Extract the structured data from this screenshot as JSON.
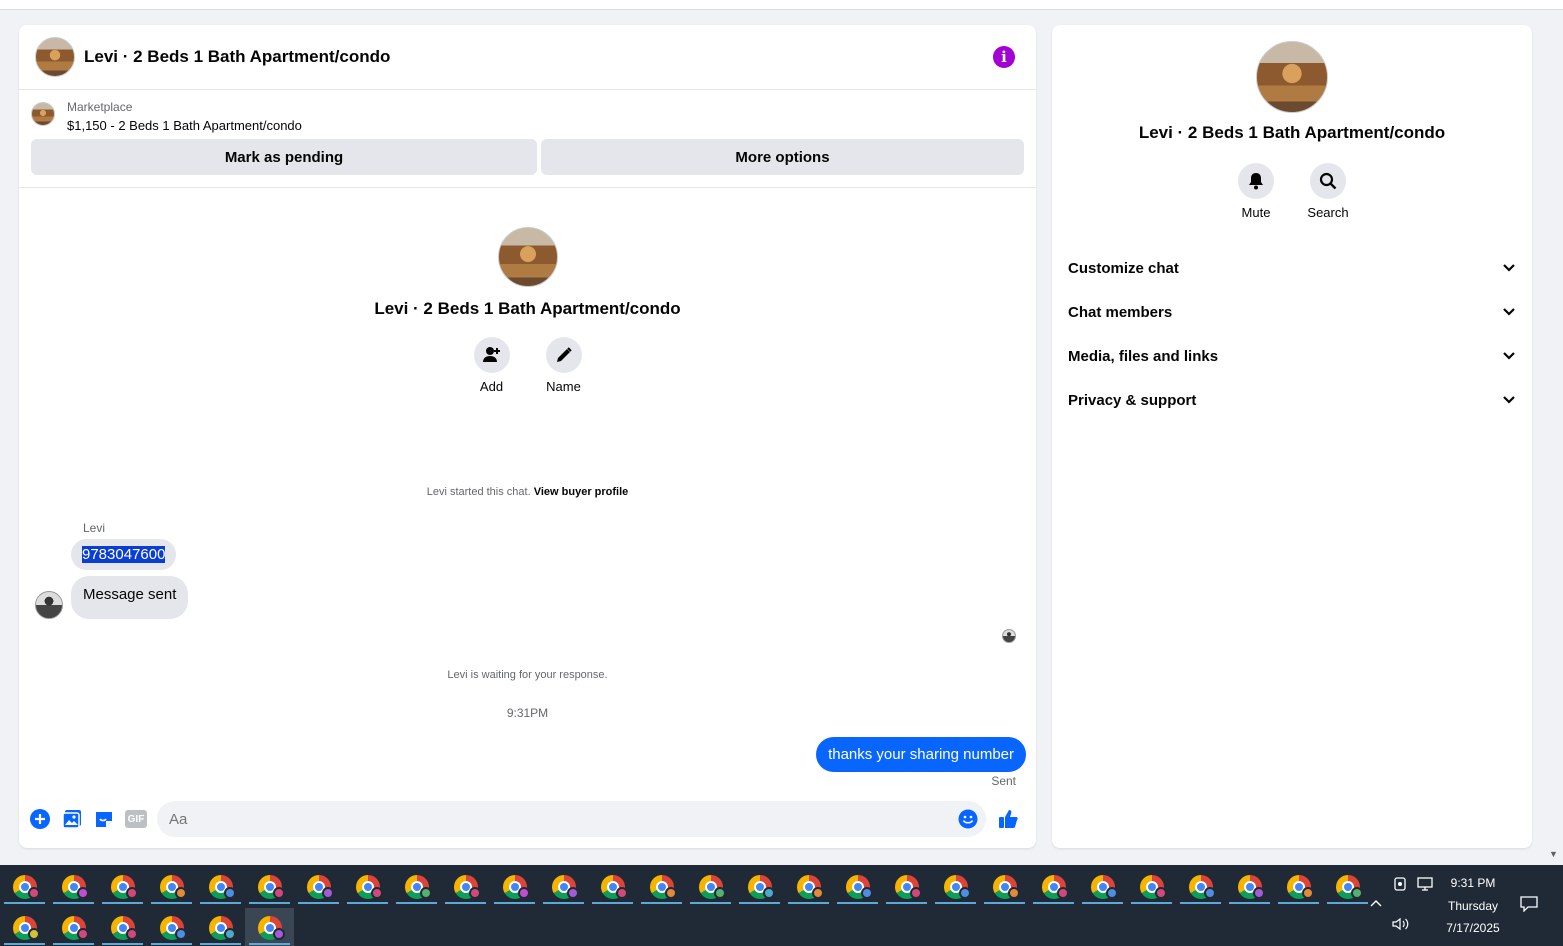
{
  "colors": {
    "accent": "#0866ff",
    "info": "#a200d4",
    "taskbar": "#1f2a36"
  },
  "chat": {
    "header_title": "Levi · 2 Beds 1 Bath Apartment/condo",
    "marketplace_label": "Marketplace",
    "listing": "$1,150 - 2 Beds 1 Bath Apartment/condo",
    "mark_pending": "Mark as pending",
    "more_options": "More options",
    "center_title": "Levi · 2 Beds 1 Bath Apartment/condo",
    "add_label": "Add",
    "name_label": "Name",
    "started_text": "Levi started this chat.",
    "view_buyer": "View buyer profile",
    "sender": "Levi",
    "msg_phone": "9783047600",
    "msg_sent": "Message sent",
    "waiting": "Levi is waiting for your response.",
    "time": "9:31PM",
    "outgoing": "thanks your sharing number",
    "sent_status": "Sent",
    "input_placeholder": "Aa",
    "gif_label": "GIF"
  },
  "side": {
    "title": "Levi · 2 Beds 1 Bath Apartment/condo",
    "mute": "Mute",
    "search": "Search",
    "menu": [
      "Customize chat",
      "Chat members",
      "Media, files and links",
      "Privacy & support"
    ]
  },
  "taskbar": {
    "time": "9:31 PM",
    "day": "Thursday",
    "date": "7/17/2025",
    "row1_badges": [
      "#d1497a",
      "#c04fd0",
      "#d1497a",
      "#e08a3a",
      "#4e8de0",
      "#d1497a",
      "#a35bd6",
      "#d1497a",
      "#53b26b",
      "#d1497a",
      "#c04fd0",
      "#a35bd6",
      "#d1497a",
      "#e08a3a",
      "#53b26b",
      "#4ea9c9",
      "#e08a3a",
      "#4e8de0",
      "#d1497a",
      "#4e8de0",
      "#e08a3a",
      "#d1497a",
      "#4e8de0",
      "#d1497a",
      "#4e8de0",
      "#a35bd6",
      "#e08a3a",
      "#53b26b"
    ],
    "row2_badges": [
      "#d1c03a",
      "#d1497a",
      "#d1497a",
      "#4e8de0",
      "#4ea9c9",
      "#a35bd6"
    ]
  }
}
